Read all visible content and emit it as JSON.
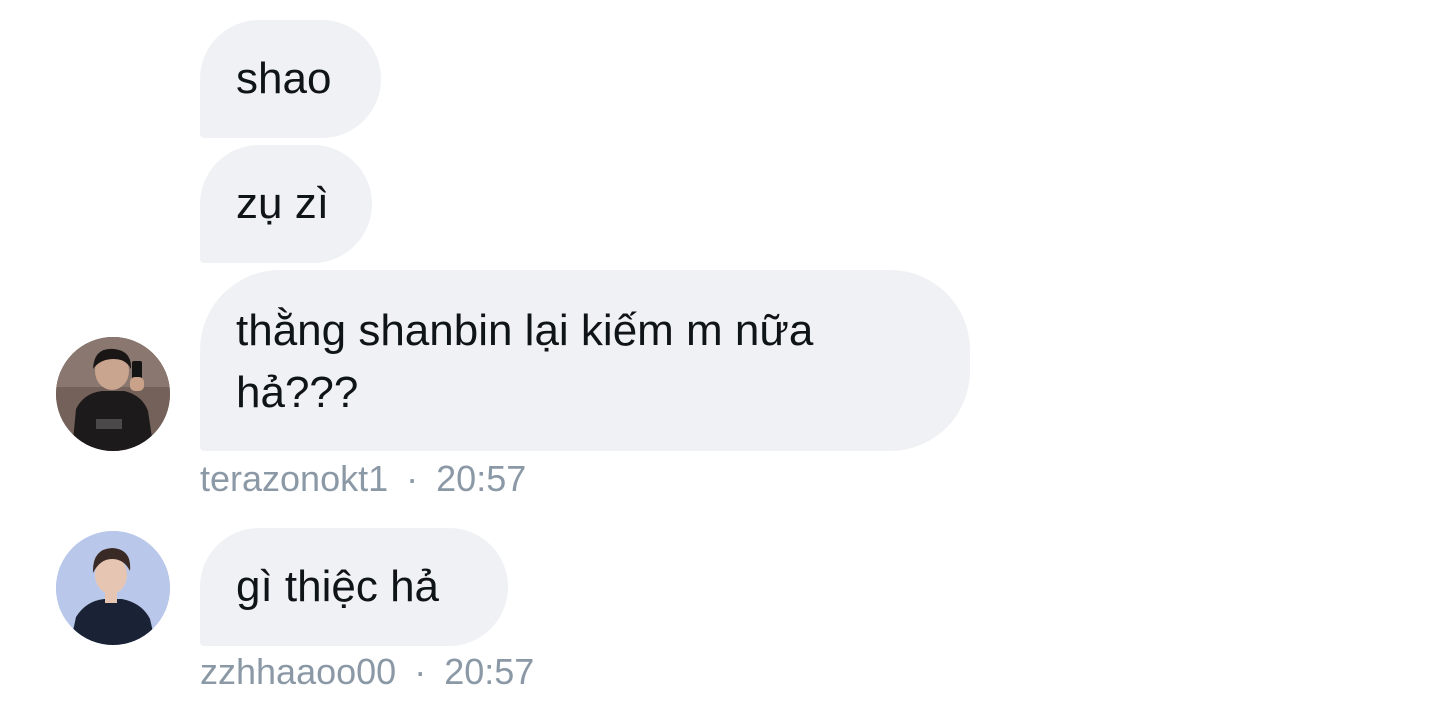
{
  "messages": [
    {
      "text": "shao"
    },
    {
      "text": "zụ zì"
    },
    {
      "text": "thằng shanbin lại kiếm m nữa hả???"
    },
    {
      "text": "gì thiệc hả"
    }
  ],
  "meta": [
    {
      "username": "terazonokt1",
      "separator": "·",
      "time": "20:57"
    },
    {
      "username": "zzhhaaoo00",
      "separator": "·",
      "time": "20:57"
    }
  ],
  "colors": {
    "bubble": "#eff1f4",
    "text": "#0f1419",
    "meta": "#8b98a5"
  }
}
